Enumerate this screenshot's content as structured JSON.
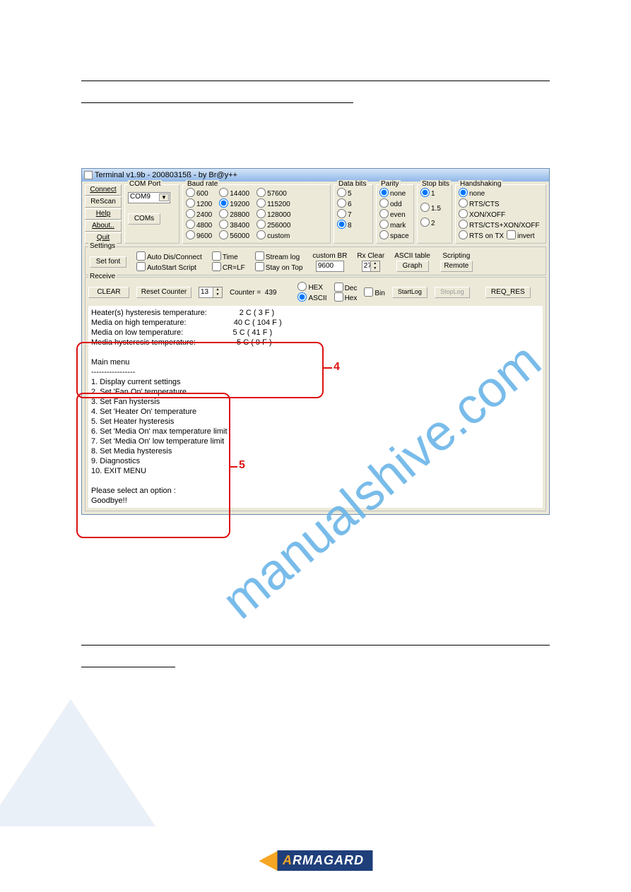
{
  "titlebar": "Terminal v1.9b - 20080315ß - by Br@y++",
  "left_buttons": {
    "connect": "Connect",
    "rescan": "ReScan",
    "help": "Help",
    "about": "About..",
    "quit": "Quit"
  },
  "comport": {
    "legend": "COM Port",
    "value": "COM9",
    "coms_btn": "COMs"
  },
  "baud": {
    "legend": "Baud rate",
    "col1": [
      "600",
      "1200",
      "2400",
      "4800",
      "9600"
    ],
    "col2": [
      "14400",
      "19200",
      "28800",
      "38400",
      "56000"
    ],
    "col3": [
      "57600",
      "115200",
      "128000",
      "256000",
      "custom"
    ],
    "selected": "19200"
  },
  "databits": {
    "legend": "Data bits",
    "opts": [
      "5",
      "6",
      "7",
      "8"
    ],
    "selected": "8"
  },
  "parity": {
    "legend": "Parity",
    "opts": [
      "none",
      "odd",
      "even",
      "mark",
      "space"
    ],
    "selected": "none"
  },
  "stopbits": {
    "legend": "Stop bits",
    "opts": [
      "1",
      "1.5",
      "2"
    ],
    "selected": "1"
  },
  "handshaking": {
    "legend": "Handshaking",
    "opts": [
      "none",
      "RTS/CTS",
      "XON/XOFF",
      "RTS/CTS+XON/XOFF"
    ],
    "selected": "none",
    "rtstx_label": "RTS on TX",
    "invert_label": "invert"
  },
  "settings": {
    "legend": "Settings",
    "setfont": "Set font",
    "autodis": "Auto Dis/Connect",
    "autostart": "AutoStart Script",
    "time": "Time",
    "crlf": "CR=LF",
    "streamlog": "Stream log",
    "stayontop": "Stay on Top",
    "custombr_label": "custom BR",
    "custombr_val": "9600",
    "rxclear_label": "Rx Clear",
    "rxclear_val": "27",
    "asciitable_label": "ASCII table",
    "graph_btn": "Graph",
    "scripting_label": "Scripting",
    "remote_btn": "Remote"
  },
  "receive": {
    "legend": "Receive",
    "clear_btn": "CLEAR",
    "reset_btn": "Reset Counter",
    "spin_val": "13",
    "counter_label": "Counter =",
    "counter_val": "439",
    "hex_radio": "HEX",
    "ascii_radio": "ASCII",
    "dec_chk": "Dec",
    "hex_chk": "Hex",
    "bin_chk": "Bin",
    "startlog": "StartLog",
    "stoplog": "StopLog",
    "reqres": "REQ_RES"
  },
  "terminal_lines_block4": [
    {
      "l": "Heater(s) hysteresis temperature:",
      "r": "2 C ( 3 F )"
    },
    {
      "l": "Media on high temperature:",
      "r": "40 C ( 104 F )"
    },
    {
      "l": "Media on low temperature:",
      "r": "5 C ( 41 F )"
    },
    {
      "l": "Media hysteresis temperature:",
      "r": "5 C ( 9 F )"
    }
  ],
  "main_menu_title": "Main menu",
  "main_menu_sep": "-----------------",
  "menu_items": [
    "1. Display current settings",
    "2. Set 'Fan On' temperature",
    "3. Set Fan hystersis",
    "4. Set 'Heater On' temperature",
    "5. Set Heater hysteresis",
    "6. Set 'Media On' max temperature limit",
    "7. Set 'Media On' low temperature limit",
    "8. Set Media hysteresis",
    "9. Diagnostics",
    "10. EXIT MENU"
  ],
  "prompt": "Please select an option :",
  "goodbye": "Goodbye!!",
  "callout_4": "4",
  "callout_5": "5",
  "watermark": "manualshive.com",
  "logo_text": "RMAGARD"
}
